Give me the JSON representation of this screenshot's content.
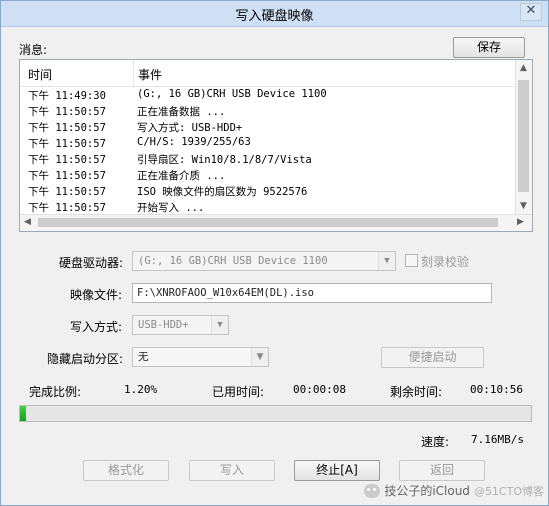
{
  "window": {
    "title": "写入硬盘映像",
    "close_glyph": "✕"
  },
  "message_section": {
    "label": "消息:",
    "save_button": "保存"
  },
  "log": {
    "columns": {
      "time": "时间",
      "event": "事件"
    },
    "rows": [
      {
        "time": "下午 11:49:30",
        "event": "(G:, 16 GB)CRH      USB Device      1100"
      },
      {
        "time": "下午 11:50:57",
        "event": "正在准备数据 ..."
      },
      {
        "time": "下午 11:50:57",
        "event": "写入方式: USB-HDD+"
      },
      {
        "time": "下午 11:50:57",
        "event": "C/H/S: 1939/255/63"
      },
      {
        "time": "下午 11:50:57",
        "event": "引导扇区: Win10/8.1/8/7/Vista"
      },
      {
        "time": "下午 11:50:57",
        "event": "正在准备介质 ..."
      },
      {
        "time": "下午 11:50:57",
        "event": "ISO 映像文件的扇区数为 9522576"
      },
      {
        "time": "下午 11:50:57",
        "event": "开始写入 ..."
      }
    ]
  },
  "form": {
    "drive_label": "硬盘驱动器:",
    "drive_value": "(G:, 16 GB)CRH      USB Device      1100",
    "verify_label": "刻录校验",
    "image_label": "映像文件:",
    "image_value": "F:\\XNROFAOO_W10x64EM(DL).iso",
    "write_mode_label": "写入方式:",
    "write_mode_value": "USB-HDD+",
    "hidden_partition_label": "隐藏启动分区:",
    "hidden_partition_value": "无",
    "quick_boot_button": "便捷启动"
  },
  "status": {
    "ratio_label": "完成比例:",
    "ratio_value": "1.20%",
    "elapsed_label": "已用时间:",
    "elapsed_value": "00:00:08",
    "remaining_label": "剩余时间:",
    "remaining_value": "00:10:56",
    "speed_label": "速度:",
    "speed_value": "7.16MB/s",
    "progress_fraction": 0.012
  },
  "buttons": {
    "format": "格式化",
    "write": "写入",
    "stop": "终止[A]",
    "back": "返回"
  },
  "watermark": {
    "text": "技公子的iCloud",
    "sub": "@51CTO博客"
  }
}
